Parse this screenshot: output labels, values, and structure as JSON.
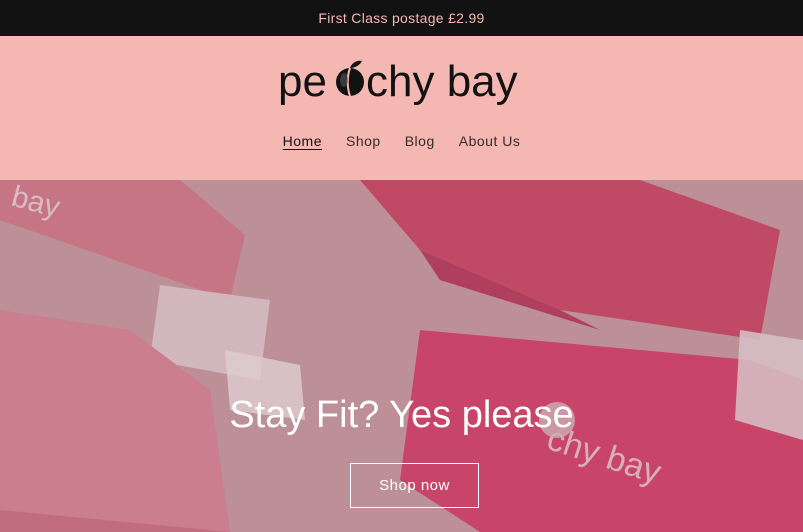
{
  "announcement": {
    "text": "First Class postage £2.99"
  },
  "brand": {
    "name": "peachy bay",
    "logo_left": "pe",
    "logo_right": "chy bay"
  },
  "nav": {
    "items": [
      {
        "label": "Home",
        "active": true
      },
      {
        "label": "Shop",
        "active": false
      },
      {
        "label": "Blog",
        "active": false
      },
      {
        "label": "About Us",
        "active": false
      }
    ]
  },
  "hero": {
    "title": "Stay Fit? Yes please",
    "button_label": "Shop now",
    "band_text": "bay",
    "band_label_right": "chy bay"
  },
  "colors": {
    "announcement_bg": "#121212",
    "announcement_text": "#f5b7b1",
    "header_bg": "#f5b7b1",
    "band_pink": "#d94b73"
  }
}
